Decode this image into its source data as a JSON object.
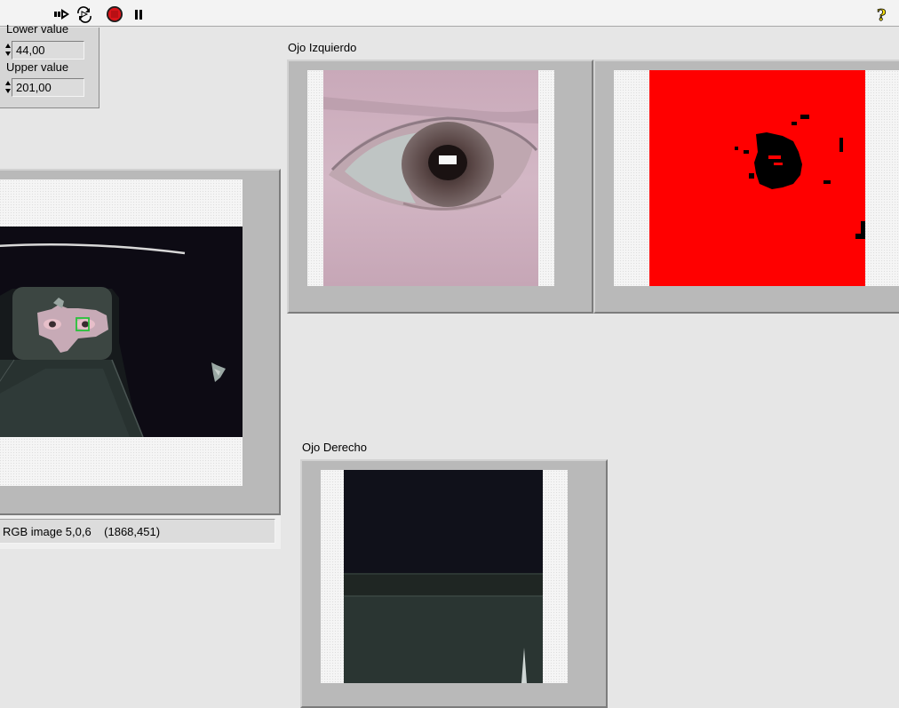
{
  "toolbar": {
    "buttons": [
      "run-arrow-icon",
      "run-continuously-icon",
      "abort-execution-icon",
      "pause-icon",
      "help-icon"
    ]
  },
  "range": {
    "lower_label": "Lower value",
    "lower_value": "44,00",
    "upper_label": "Upper value",
    "upper_value": "201,00"
  },
  "main_image": {
    "status_text": "RGB image 5,0,6    (1868,451)"
  },
  "left_eye": {
    "title": "Ojo Izquierdo"
  },
  "right_eye": {
    "title": "Ojo Derecho"
  },
  "colors": {
    "threshold_red": "#ff0000",
    "roi_green": "#27c23a",
    "abort_red": "#d8141a"
  }
}
